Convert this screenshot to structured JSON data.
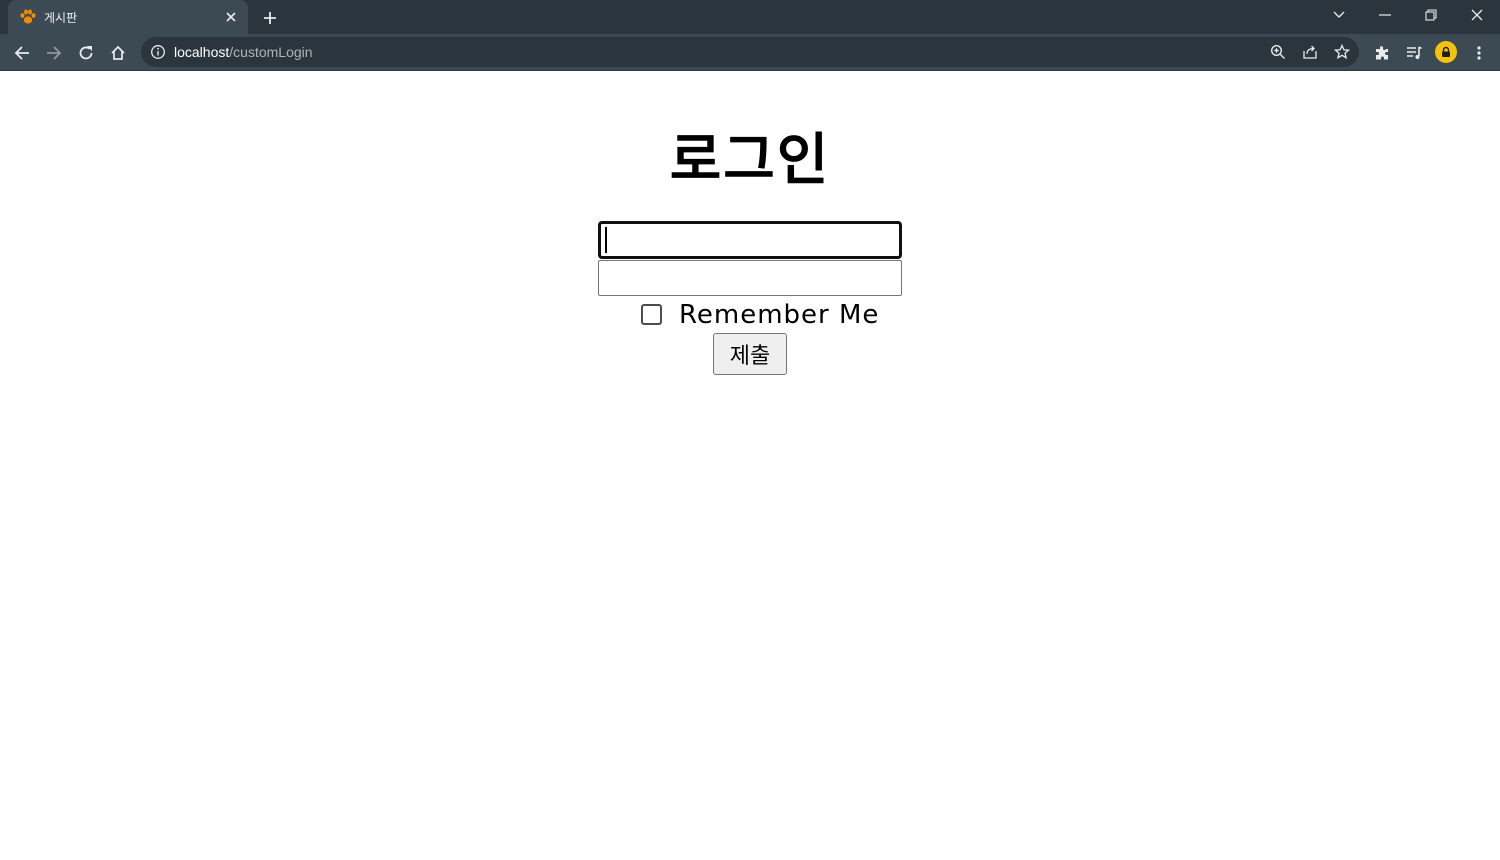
{
  "browser": {
    "tab": {
      "title": "게시판",
      "favicon": "paw-icon"
    },
    "address": {
      "host": "localhost",
      "path": "/customLogin"
    },
    "colors": {
      "tabstrip": "#2b353d",
      "toolbar": "#3c4a54",
      "avatar": "#f4c20d"
    }
  },
  "page": {
    "title": "로그인",
    "username": {
      "value": "",
      "placeholder": ""
    },
    "password": {
      "value": "",
      "placeholder": ""
    },
    "remember_me": {
      "label": "Remember Me",
      "checked": false
    },
    "submit_label": "제출"
  }
}
